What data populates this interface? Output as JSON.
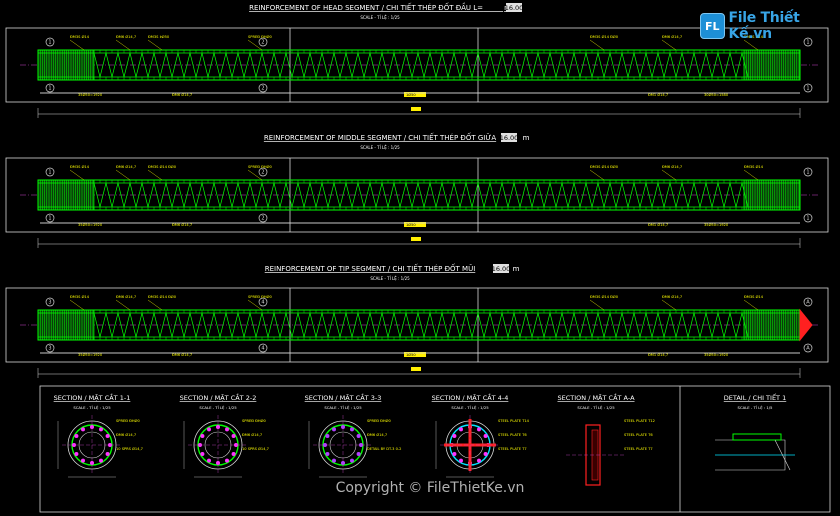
{
  "watermark": {
    "badge": "FL",
    "text": "File Thiết Kế.vn"
  },
  "copyright": "Copyright © FileThietKe.vn",
  "segments": [
    {
      "title_prefix": "REINFORCEMENT OF HEAD SEGMENT  / CHI TIẾT THÉP ĐỐT ĐẦU L=",
      "title_value": "16.00",
      "title_unit": "m",
      "scale": "SCALE - TỈ LỆ : 1/25",
      "top_labels": [
        "ĐM3S Ø14",
        "ĐM6 Ø14,7",
        "ĐM3S ÞØ50",
        "SPREĐ ĐHØ0",
        "ĐM3S Ø14 ĐØ0",
        "ĐM6 Ø14,7",
        "ĐM3S Ø14"
      ],
      "bottom_labels": [
        "35Ø50=1920",
        "ĐM6 Ø14,7",
        "1Ø50",
        "ĐM1 Ø14,7",
        "30Ø50=1580"
      ]
    },
    {
      "title_prefix": "REINFORCEMENT OF MIDDLE SEGMENT  / CHI TIẾT THÉP ĐỐT GIỮA",
      "title_value": "16.00",
      "title_unit": "m",
      "scale": "SCALE - TỈ LỆ : 1/25",
      "top_labels": [
        "ĐM3S Ø14",
        "ĐM6 Ø14,7",
        "ĐM3S Ø14 ĐØ0",
        "SPREĐ ĐHØ0",
        "ĐM3S Ø14 ĐØ0",
        "ĐM6 Ø14,7",
        "ĐM3S Ø14"
      ],
      "bottom_labels": [
        "35Ø50=1920",
        "ĐM6 Ø14,7",
        "1Ø50",
        "ĐM1 Ø14,7",
        "35Ø50=1920"
      ]
    },
    {
      "title_prefix": "REINFORCEMENT OF TIP SEGMENT  / CHI TIẾT THÉP ĐỐT MŨI",
      "title_value": "16.00",
      "title_unit": "m",
      "scale": "SCALE - TỈ LỆ : 1/25",
      "top_labels": [
        "ĐM3S Ø14",
        "ĐM6 Ø14,7",
        "ĐM3S Ø14 ĐØ0",
        "SPREĐ ĐHØ0",
        "ĐM3S Ø14 ĐØ0",
        "ĐM6 Ø14,7",
        "ĐM3S Ø14"
      ],
      "bottom_labels": [
        "35Ø50=1920",
        "ĐM6 Ø14,7",
        "1Ø50",
        "ĐM1 Ø14,7",
        "35Ø50=1920"
      ]
    }
  ],
  "sections": [
    {
      "title": "SECTION / MẶT CẮT 1-1",
      "scale": "SCALE - TỈ LỆ : 1/25",
      "notes": [
        "SPREĐ ĐHØ0",
        "ĐM6 Ø14,7",
        "10 SPRS Ø14,7"
      ]
    },
    {
      "title": "SECTION / MẶT CẮT 2-2",
      "scale": "SCALE - TỈ LỆ : 1/25",
      "notes": [
        "SPREĐ ĐHØ0",
        "ĐM6 Ø14,7",
        "10 SPRS Ø14,7"
      ]
    },
    {
      "title": "SECTION / MẶT CẮT 3-3",
      "scale": "SCALE - TỈ LỆ : 1/25",
      "notes": [
        "SPREĐ ĐHØ0",
        "ĐM6 Ø14,7",
        "DETAIL BY DT-3 0-2"
      ]
    },
    {
      "title": "SECTION / MẶT CẮT 4-4",
      "scale": "SCALE - TỈ LỆ : 1/25",
      "notes": [
        "STEEL PLATE T14",
        "STEEL PLATE T6",
        "STEEL PLATE T7"
      ]
    },
    {
      "title": "SECTION / MẶT CẮT A-A",
      "scale": "SCALE - TỈ LỆ : 1/25",
      "notes": [
        "STEEL PLATE T12",
        "STEEL PLATE T6",
        "STEEL PLATE T7"
      ]
    },
    {
      "title": "DETAIL / CHI TIẾT 1",
      "scale": "SCALE - TỈ LỆ : 1/5",
      "notes": []
    }
  ],
  "colors": {
    "background": "#000000",
    "rebar": "#00ff00",
    "frame": "#d8d8d8",
    "title": "#ffffff",
    "label": "#ffff00",
    "pink_link": "#ff33ff",
    "centerline": "#cc44cc",
    "plate": "#ff2020",
    "circle": "#00e5ff"
  }
}
